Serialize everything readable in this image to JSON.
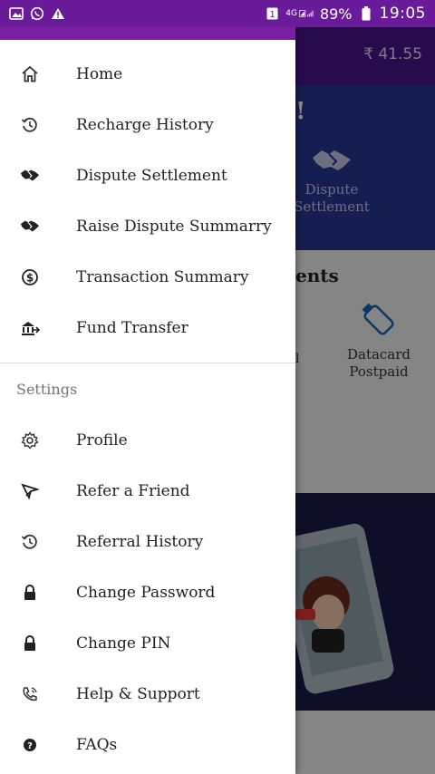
{
  "status_bar": {
    "network": "4G",
    "battery": "89%",
    "time": "19:05",
    "icons": [
      "gallery-icon",
      "whatsapp-icon",
      "alert-icon",
      "sim-icon",
      "signal-icon",
      "battery-icon"
    ]
  },
  "background_app": {
    "balance": "₹ 41.55",
    "banner_fragment": "!",
    "dispute_tile_label": "Dispute\nSettlement",
    "section_title_fragment": "ents",
    "datacard_label": "Datacard\nPostpaid",
    "left_fragment": "l"
  },
  "drawer": {
    "items": [
      {
        "label": "Home",
        "icon": "home-icon"
      },
      {
        "label": "Recharge History",
        "icon": "history-icon"
      },
      {
        "label": "Dispute Settlement",
        "icon": "handshake-icon"
      },
      {
        "label": "Raise Dispute Summarry",
        "icon": "handshake-icon"
      },
      {
        "label": "Transaction Summary",
        "icon": "dollar-coin-icon"
      },
      {
        "label": "Fund Transfer",
        "icon": "bank-transfer-icon"
      }
    ],
    "settings_header": "Settings",
    "settings_items": [
      {
        "label": "Profile",
        "icon": "gear-icon"
      },
      {
        "label": "Refer a Friend",
        "icon": "plane-icon"
      },
      {
        "label": "Referral History",
        "icon": "history-icon"
      },
      {
        "label": "Change Password",
        "icon": "lock-icon"
      },
      {
        "label": "Change PIN",
        "icon": "lock-icon"
      },
      {
        "label": "Help & Support",
        "icon": "phone-icon"
      },
      {
        "label": "FAQs",
        "icon": "question-icon"
      }
    ]
  },
  "colors": {
    "status_bar": "#6a1b9a",
    "header": "#4a148c",
    "drawer_accent": "#7b1fa2",
    "banner": "#283593"
  }
}
